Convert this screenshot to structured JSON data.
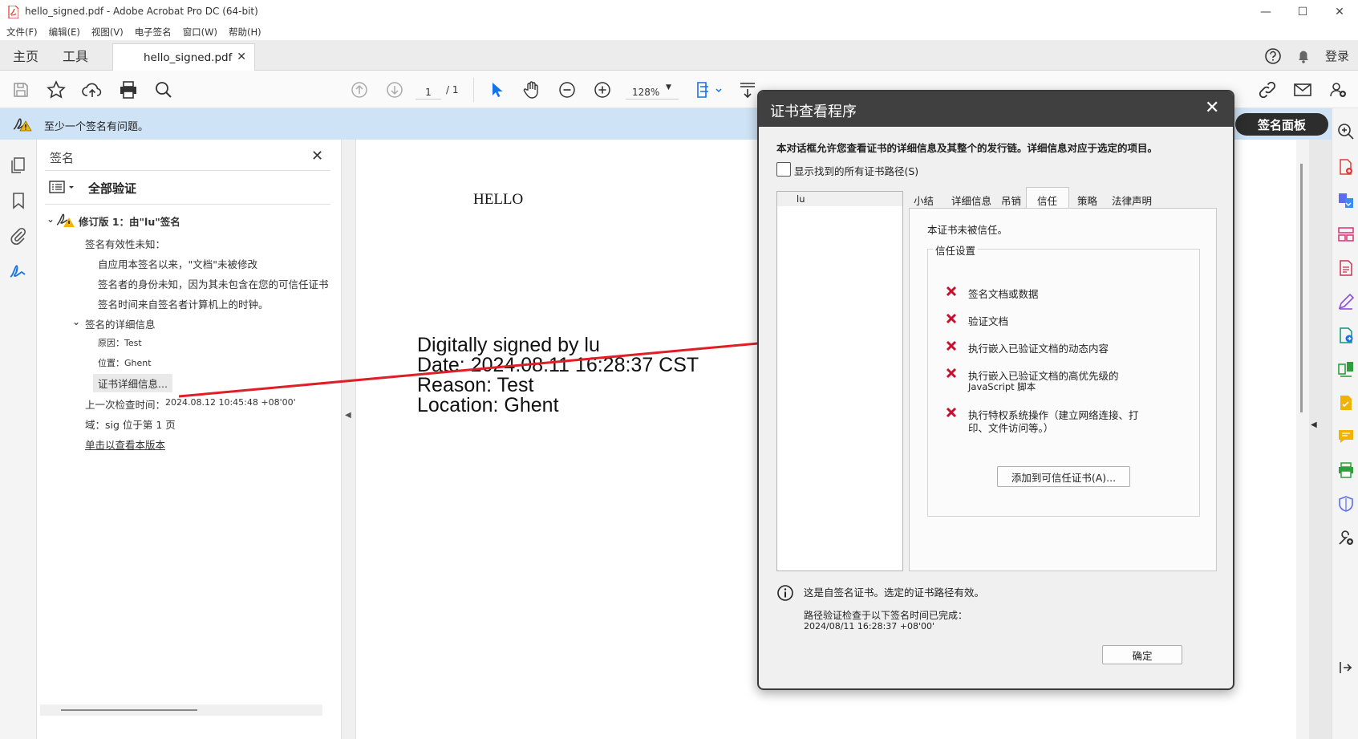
{
  "window": {
    "title": "hello_signed.pdf - Adobe Acrobat Pro DC (64-bit)"
  },
  "menu": [
    "文件(F)",
    "编辑(E)",
    "视图(V)",
    "电子签名",
    "窗口(W)",
    "帮助(H)"
  ],
  "tabs": {
    "home": "主页",
    "tools": "工具",
    "document": "hello_signed.pdf",
    "login": "登录"
  },
  "toolbar": {
    "page_current": "1",
    "page_total": "/ 1",
    "zoom": "128%"
  },
  "notification": {
    "text": "至少一个签名有问题。",
    "panel_button": "签名面板"
  },
  "sig_panel": {
    "title": "签名",
    "verify_all": "全部验证",
    "revision": "修订版 1：由\"lu\"签名",
    "validity_unknown": "签名有效性未知：",
    "not_modified": "自应用本签名以来，\"文档\"未被修改",
    "identity_unknown": "签名者的身份未知，因为其未包含在您的可信任证书",
    "time_local": "签名时间来自签名者计算机上的时钟。",
    "details_header": "签名的详细信息",
    "reason": "原因：Test",
    "location": "位置：Ghent",
    "cert_details": "证书详细信息...",
    "last_checked_label": "上一次检查时间：",
    "last_checked_value": "2024.08.12 10:45:48 +08'00'",
    "field": "域：sig 位于第 1 页",
    "view_version": "单击以查看本版本"
  },
  "document": {
    "hello": "HELLO",
    "sig_line1": "Digitally signed by lu",
    "sig_line2": "Date: 2024.08.11 16:28:37 CST",
    "sig_line3": "Reason: Test",
    "sig_line4": "Location: Ghent"
  },
  "dialog": {
    "title": "证书查看程序",
    "description": "本对话框允许您查看证书的详细信息及其整个的发行链。详细信息对应于选定的项目。",
    "show_all_paths": "显示找到的所有证书路径(S)",
    "tree_item": "lu",
    "tabs": [
      "小结",
      "详细信息",
      "吊销",
      "信任",
      "策略",
      "法律声明"
    ],
    "not_trusted": "本证书未被信任。",
    "trust_settings": "信任设置",
    "trust_items": [
      "签名文档或数据",
      "验证文档",
      "执行嵌入已验证文档的动态内容",
      "执行嵌入已验证文档的高优先级的",
      "JavaScript 脚本",
      "执行特权系统操作（建立网络连接、打",
      "印、文件访问等。）"
    ],
    "add_trusted": "添加到可信任证书(A)...",
    "self_signed": "这是自签名证书。选定的证书路径有效。",
    "path_validated": "路径验证检查于以下签名时间已完成：",
    "path_time": "2024/08/11 16:28:37 +08'00'",
    "ok": "确定"
  },
  "colors": {
    "accent": "#1473e6",
    "notif_bg": "#cfe3f7",
    "dialog_header": "#404040",
    "arrow": "#e01e26",
    "xmark": "#c8102e"
  }
}
